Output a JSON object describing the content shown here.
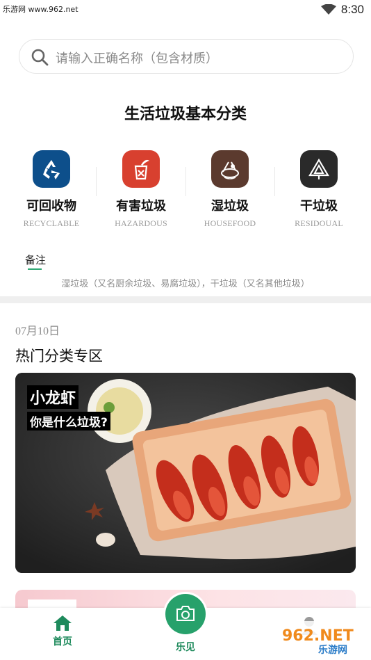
{
  "status_bar": {
    "site": "乐游网 www.962.net",
    "time": "8:30"
  },
  "search": {
    "placeholder": "请输入正确名称（包含材质）"
  },
  "page_title": "生活垃圾基本分类",
  "categories": [
    {
      "zh": "可回收物",
      "en": "RECYCLABLE",
      "color": "#0d4f8b",
      "icon": "recycle-icon"
    },
    {
      "zh": "有害垃圾",
      "en": "HAZARDOUS",
      "color": "#d8402f",
      "icon": "hazard-icon"
    },
    {
      "zh": "湿垃圾",
      "en": "HOUSEFOOD",
      "color": "#5b3a2e",
      "icon": "food-waste-icon"
    },
    {
      "zh": "干垃圾",
      "en": "RESIDOUAL",
      "color": "#2a2a2a",
      "icon": "residual-icon"
    }
  ],
  "note": {
    "tab": "备注",
    "text": "湿垃圾（又名厨余垃圾、易腐垃圾），干垃圾（又名其他垃圾）"
  },
  "feed": {
    "date": "07月10日",
    "section_title": "热门分类专区",
    "feature_card": {
      "caption_1": "小龙虾",
      "caption_2": "你是什么垃圾?"
    }
  },
  "bottom_nav": {
    "home": "首页",
    "camera": "乐见",
    "accent": "#27a16b"
  },
  "watermark": {
    "brand": "962.NET",
    "sub": "乐游网"
  }
}
